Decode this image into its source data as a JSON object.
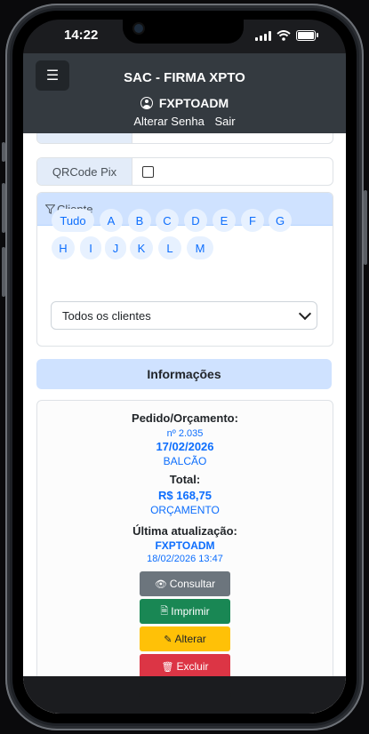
{
  "status": {
    "time": "14:22"
  },
  "header": {
    "menu_icon": "hamburger-menu-icon",
    "title": "SAC - FIRMA XPTO",
    "username": "FXPTOADM",
    "change_password": "Alterar Senha",
    "logout": "Sair"
  },
  "form": {
    "qrcode_label": "QRCode Pix",
    "qrcode_checked": false
  },
  "client_filter": {
    "title": "Cliente",
    "letters": [
      "Tudo",
      "A",
      "B",
      "C",
      "D",
      "E",
      "F",
      "G",
      "H",
      "I",
      "J",
      "K",
      "L",
      "M"
    ],
    "selected_client": "Todos os clientes"
  },
  "info": {
    "section_title": "Informações",
    "order_label": "Pedido/Orçamento:",
    "order_number": "nº 2.035",
    "order_date": "17/02/2026",
    "order_channel": "BALCÃO",
    "total_label": "Total:",
    "total_value": "R$ 168,75",
    "total_type": "ORÇAMENTO",
    "update_label": "Última atualização:",
    "update_user": "FXPTOADM",
    "update_datetime": "18/02/2026 13:47"
  },
  "actions": {
    "view": "Consultar",
    "print": "Imprimir",
    "edit": "Alterar",
    "delete": "Excluir"
  },
  "colors": {
    "header_bg": "#343a40",
    "primary": "#0d6efd",
    "secondary_btn": "#6c757d",
    "success_btn": "#198754",
    "warning_btn": "#ffc107",
    "danger_btn": "#dc3545",
    "light_blue": "#cfe2ff"
  }
}
